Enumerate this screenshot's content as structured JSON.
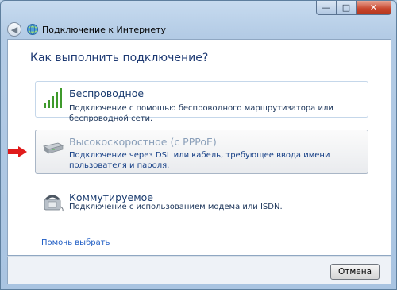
{
  "window": {
    "title": "Подключение к Интернету"
  },
  "heading": "Как выполнить подключение?",
  "options": [
    {
      "title": "Беспроводное",
      "description": "Подключение с помощью беспроводного маршрутизатора или беспроводной сети.",
      "icon": "wireless-signal-icon"
    },
    {
      "title": "Высокоскоростное (с PPPoE)",
      "description": "Подключение через DSL или кабель, требующее ввода имени пользователя и пароля.",
      "icon": "modem-icon"
    },
    {
      "title": "Коммутируемое",
      "description": "Подключение с использованием модема или ISDN.",
      "icon": "telephone-modem-icon"
    }
  ],
  "help_link": "Помочь выбрать",
  "buttons": {
    "cancel": "Отмена"
  },
  "colors": {
    "heading": "#1e3a73",
    "link": "#1f5dc4",
    "arrow": "#e01b1b",
    "accent_bars": "#3f9a2c"
  }
}
